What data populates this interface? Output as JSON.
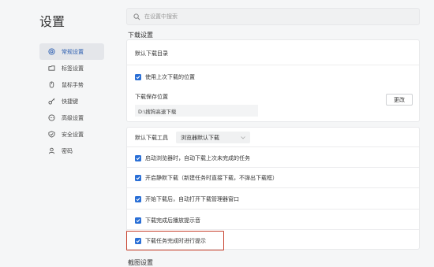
{
  "app": {
    "title": "设置"
  },
  "search": {
    "placeholder": "在设置中搜索"
  },
  "sidebar": {
    "items": [
      {
        "label": "常规设置",
        "icon": "gear-icon",
        "active": true
      },
      {
        "label": "标签设置",
        "icon": "tab-icon",
        "active": false
      },
      {
        "label": "鼠标手势",
        "icon": "mouse-icon",
        "active": false
      },
      {
        "label": "快捷键",
        "icon": "key-icon",
        "active": false
      },
      {
        "label": "高级设置",
        "icon": "advanced-icon",
        "active": false
      },
      {
        "label": "安全设置",
        "icon": "shield-icon",
        "active": false
      },
      {
        "label": "密码",
        "icon": "user-icon",
        "active": false
      }
    ]
  },
  "download": {
    "section_title": "下载设置",
    "default_dir_label": "默认下载目录",
    "use_last_location_label": "使用上次下载的位置",
    "save_location_label": "下载保存位置",
    "save_path": "D:\\搜狗高速下载",
    "change_button": "更改",
    "tool_label": "默认下载工具",
    "tool_value": "浏览器默认下载",
    "options": [
      "启动浏览器时，自动下载上次未完成的任务",
      "开启静默下载（新建任务时直接下载，不弹出下载框）",
      "开始下载后，自动打开下载管理器窗口",
      "下载完成后播放提示音",
      "下载任务完成时进行提示"
    ]
  },
  "next_section": {
    "title": "截图设置"
  },
  "colors": {
    "accent": "#2a6fd6",
    "highlight": "#c8432f"
  }
}
